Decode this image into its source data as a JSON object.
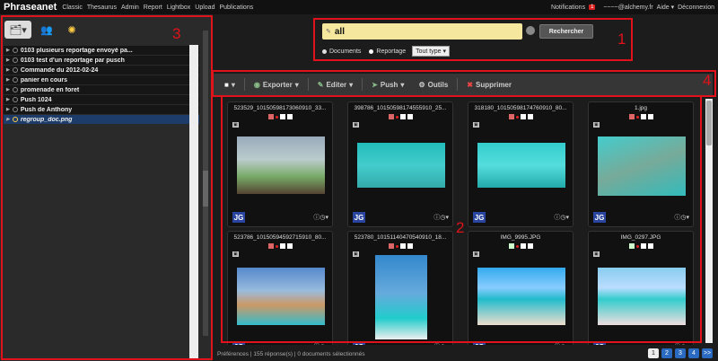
{
  "topbar": {
    "logo": "Phraseanet",
    "nav": [
      "Classic",
      "Thesaurus",
      "Admin",
      "Report",
      "Lightbox",
      "Upload",
      "Publications"
    ],
    "notifications_label": "Notifications",
    "notifications_count": "1",
    "user": "~~~~@alchemy.fr",
    "help": "Aide ▾",
    "logout": "Déconnexion"
  },
  "baskets": [
    {
      "label": "0103 plusieurs reportage envoyé pa..."
    },
    {
      "label": "0103 test d'un reportage par pusch"
    },
    {
      "label": "Commande du 2012-02-24"
    },
    {
      "label": "panier en cours"
    },
    {
      "label": "promenade en foret"
    },
    {
      "label": "Push 1024"
    },
    {
      "label": "Push de Anthony"
    },
    {
      "label": "regroup_doc.png"
    }
  ],
  "search": {
    "query": "all",
    "button": "Rechercher",
    "opt_documents": "Documents",
    "opt_reportage": "Reportage",
    "type_select": "Tout type"
  },
  "toolbar": {
    "exporter": "Exporter",
    "editer": "Editer",
    "push": "Push",
    "outils": "Outils",
    "supprimer": "Supprimer"
  },
  "cards": [
    {
      "title": "523529_10150598173060910_33...",
      "initials": "JG"
    },
    {
      "title": "398786_10150598174555910_25...",
      "initials": "JG"
    },
    {
      "title": "318180_10150598174760910_80...",
      "initials": "JG"
    },
    {
      "title": "1.jpg",
      "initials": "JG"
    },
    {
      "title": "523786_10150594592715910_80...",
      "initials": "JG"
    },
    {
      "title": "523780_10151140470540910_18...",
      "initials": "JG"
    },
    {
      "title": "IMG_9995.JPG",
      "initials": "JG"
    },
    {
      "title": "IMG_0297.JPG",
      "initials": "JG"
    }
  ],
  "status": {
    "text": "Préférences | 155 réponse(s) | 0 documents sélectionnés",
    "pages": [
      "1",
      "2",
      "3",
      "4",
      ">>"
    ]
  },
  "annotations": [
    "1",
    "2",
    "3",
    "4"
  ],
  "colors": {
    "annotation_red": "#e0121a",
    "selected_basket": "#1e3c6a",
    "query_bg": "#f5e79e"
  }
}
